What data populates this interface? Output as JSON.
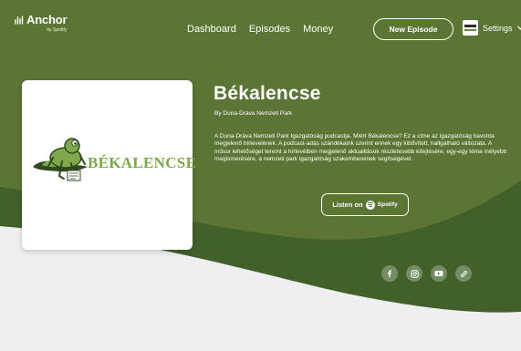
{
  "brand": {
    "logo_name": "Anchor",
    "logo_sub": "by Spotify"
  },
  "nav": {
    "items": [
      {
        "label": "Dashboard"
      },
      {
        "label": "Episodes"
      },
      {
        "label": "Money"
      }
    ],
    "new_episode_label": "New Episode",
    "settings_label": "Settings"
  },
  "podcast": {
    "cover_title": "BÉKALENCSE",
    "title": "Békalencse",
    "author": "By Duna-Dráva Nemzeti Park",
    "description": "A Duna-Dráva Nemzeti Park Igazgatóság podcastja. Miért Békalencse? Ez a címe az igazgatóság havonta megjelenő hírlevelének. A podcast-adás szándékaink szerint ennek egy kibővített, hallgatható változata. A műsor lehetőséget teremt a hírlevélben megjelenő aktualitások részletesebb kifejtésére, egy-egy téma mélyebb megismerésére, a nemzeti park igazgatóság szakembereinek segítségével.",
    "listen_label": "Listen on",
    "listen_platform": "Spotify"
  },
  "social": [
    {
      "icon": "facebook-icon"
    },
    {
      "icon": "instagram-icon"
    },
    {
      "icon": "youtube-icon"
    },
    {
      "icon": "link-icon"
    }
  ],
  "colors": {
    "hero_green": "#5b7534",
    "curve_green": "#42602a",
    "page_bg": "#f1f1f1",
    "cover_title_green": "#7ea84a"
  }
}
